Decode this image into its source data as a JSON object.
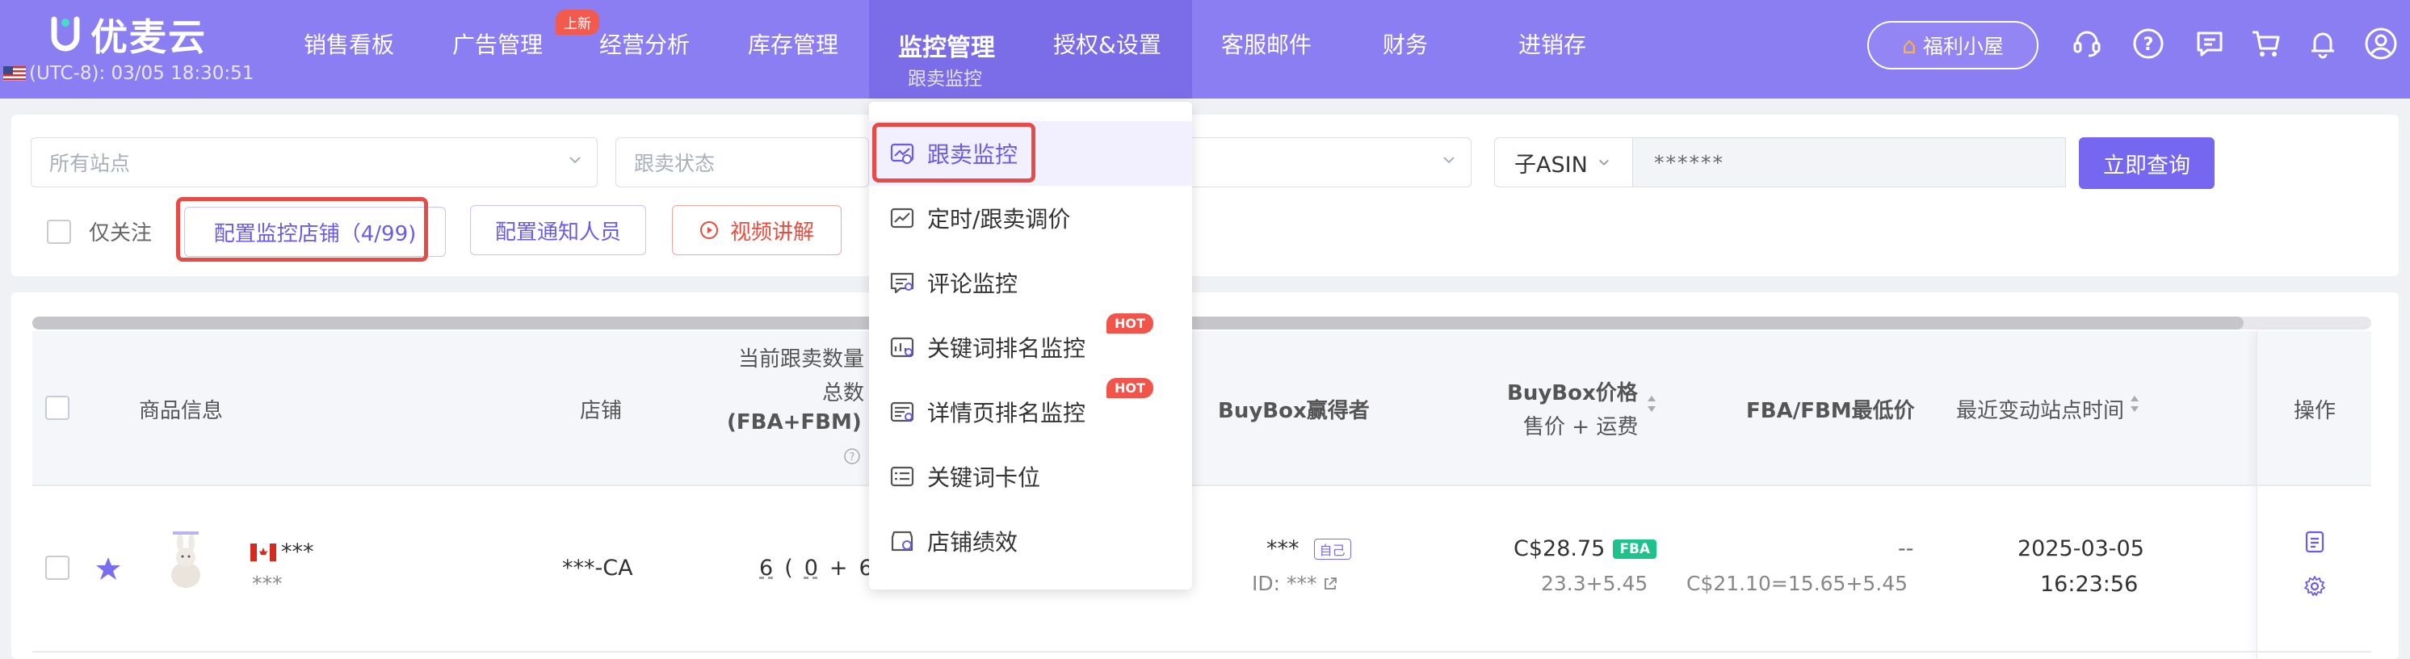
{
  "app": {
    "logo_text": "优麦云",
    "clock": "(UTC-8): 03/05 18:30:51"
  },
  "nav": {
    "items": [
      "销售看板",
      "广告管理",
      "经营分析",
      "库存管理",
      "授权&设置",
      "客服邮件",
      "财务",
      "进销存"
    ],
    "active": {
      "label": "监控管理",
      "sub": "跟卖监控"
    },
    "new_badge": "上新",
    "welfare": "福利小屋"
  },
  "filters": {
    "site_placeholder": "所有站点",
    "status_placeholder": "跟卖状态",
    "asin_type": "子ASIN",
    "asin_value": "******",
    "query_label": "立即查询",
    "only_follow": "仅关注",
    "config_store": "配置监控店铺（4/99)",
    "config_notify": "配置通知人员",
    "video": "视频讲解"
  },
  "dropdown": {
    "items": [
      {
        "label": "跟卖监控",
        "icon": "follow-sell-icon"
      },
      {
        "label": "定时/跟卖调价",
        "icon": "price-chart-icon"
      },
      {
        "label": "评论监控",
        "icon": "review-icon"
      },
      {
        "label": "关键词排名监控",
        "icon": "keyword-rank-icon",
        "hot": "HOT"
      },
      {
        "label": "详情页排名监控",
        "icon": "detail-rank-icon",
        "hot": "HOT"
      },
      {
        "label": "关键词卡位",
        "icon": "keyword-slot-icon"
      },
      {
        "label": "店铺绩效",
        "icon": "store-perf-icon"
      }
    ]
  },
  "table": {
    "headers": {
      "product": "商品信息",
      "store": "店铺",
      "follow_count_1": "当前跟卖数量",
      "follow_count_2": "总数",
      "follow_count_3": "(FBA+FBM)",
      "buybox_winner": "BuyBox赢得者",
      "buybox_price_1": "BuyBox价格",
      "buybox_price_2": "售价 + 运费",
      "fba_fbm_min": "FBA/FBM最低价",
      "recent_change": "最近变动站点时间",
      "ops": "操作"
    },
    "row": {
      "title": "***",
      "sku": "***",
      "store": "***-CA",
      "count_total": "6",
      "count_open": "(",
      "count_fba": "0",
      "count_plus": "+",
      "count_fbm": "6",
      "winner": "***",
      "self_tag": "自己",
      "winner_id": "ID: ***",
      "price": "C$28.75",
      "fba_tag": "FBA",
      "price_detail": "23.3+5.45",
      "min_price": "--",
      "min_price_detail": "C$21.10=15.65+5.45",
      "date": "2025-03-05",
      "time": "16:23:56"
    }
  },
  "colors": {
    "header": "#8b7ef2",
    "accent": "#7667f0",
    "red": "#e64b46",
    "hot": "#f0544a",
    "fba": "#1fc28a"
  }
}
